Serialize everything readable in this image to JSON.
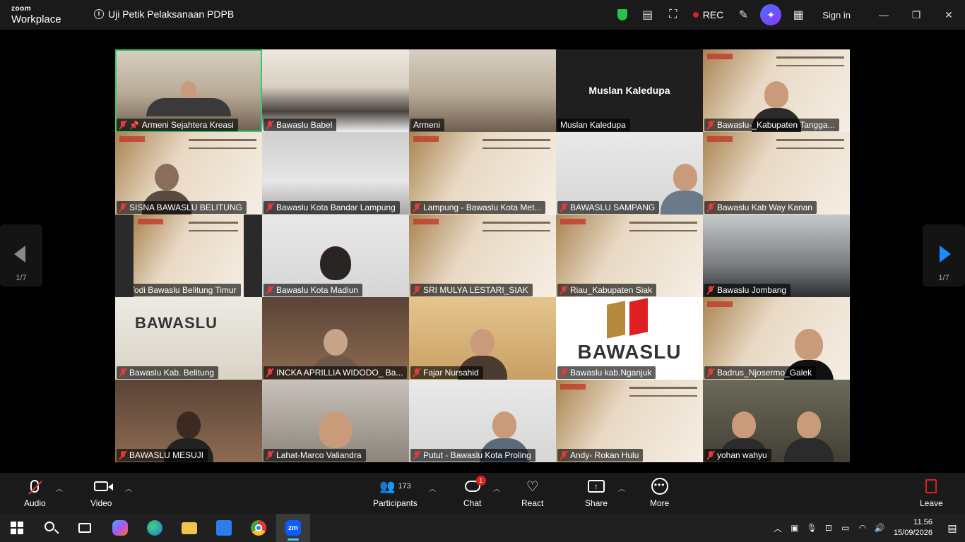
{
  "app": {
    "logo_line1": "zoom",
    "logo_line2": "Workplace",
    "meeting_title": "Uji Petik Pelaksanaan PDPB",
    "recording_label": "REC",
    "sign_in_label": "Sign in",
    "colors": {
      "accent": "#0b5cff",
      "active_speaker": "#2ecc71",
      "muted": "#e23b3b",
      "rec": "#e02020"
    }
  },
  "gallery": {
    "page_indicator_left": "1/7",
    "page_indicator_right": "1/7",
    "center_name": "Muslan Kaledupa",
    "tiles": [
      {
        "name": "Armeni Sejahtera Kreasi",
        "muted": true,
        "pinned": true
      },
      {
        "name": "Bawaslu Babel",
        "muted": true
      },
      {
        "name": "Armeni",
        "muted": false
      },
      {
        "name": "Muslan Kaledupa",
        "muted": false
      },
      {
        "name": "Bawaslu-_Kabupaten Tangga...",
        "muted": true
      },
      {
        "name": "SISNA BAWASLU BELITUNG",
        "muted": true
      },
      {
        "name": "Bawaslu Kota Bandar Lampung",
        "muted": true
      },
      {
        "name": "Lampung - Bawaslu Kota Met...",
        "muted": true
      },
      {
        "name": "BAWASLU SAMPANG",
        "muted": true
      },
      {
        "name": "Bawaslu Kab Way Kanan",
        "muted": true
      },
      {
        "name": "Yodi Bawaslu Belitung Timur",
        "muted": true
      },
      {
        "name": "Bawaslu Kota Madiun",
        "muted": true
      },
      {
        "name": "SRI MULYA LESTARI_SIAK",
        "muted": true
      },
      {
        "name": "Riau_Kabupaten Siak",
        "muted": true
      },
      {
        "name": "Bawaslu Jombang",
        "muted": true
      },
      {
        "name": "Bawaslu Kab. Belitung",
        "muted": true
      },
      {
        "name": "INCKA APRILLIA WIDODO_ Ba...",
        "muted": true
      },
      {
        "name": "Fajar Nursahid",
        "muted": true
      },
      {
        "name": "Bawaslu kab.Nganjuk",
        "muted": true
      },
      {
        "name": "Badrus_Njosermo_Galek",
        "muted": true
      },
      {
        "name": "BAWASLU MESUJI",
        "muted": true
      },
      {
        "name": "Lahat-Marco Valiandra",
        "muted": true
      },
      {
        "name": "Putut - Bawaslu Kota Proling",
        "muted": true
      },
      {
        "name": "Andy- Rokan Hulu",
        "muted": true
      },
      {
        "name": "yohan wahyu",
        "muted": true
      }
    ],
    "logo_tile_text": "BAWASLU"
  },
  "toolbar": {
    "audio": "Audio",
    "video": "Video",
    "participants": "Participants",
    "participants_count": "173",
    "chat": "Chat",
    "chat_badge": "1",
    "react": "React",
    "share": "Share",
    "more": "More",
    "leave": "Leave"
  },
  "taskbar": {
    "time": "11.56",
    "date": "15/09/2026"
  }
}
